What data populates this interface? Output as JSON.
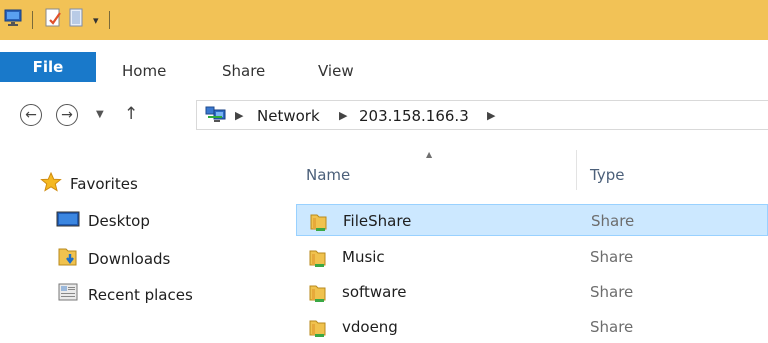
{
  "ribbon": {
    "tabs": [
      "File",
      "Home",
      "Share",
      "View"
    ]
  },
  "address": {
    "breadcrumbs": [
      "Network",
      "203.158.166.3"
    ]
  },
  "nav": {
    "favorites_label": "Favorites",
    "items": [
      "Desktop",
      "Downloads",
      "Recent places"
    ]
  },
  "list": {
    "columns": [
      "Name",
      "Type"
    ],
    "rows": [
      {
        "name": "FileShare",
        "type": "Share"
      },
      {
        "name": "Music",
        "type": "Share"
      },
      {
        "name": "software",
        "type": "Share"
      },
      {
        "name": "vdoeng",
        "type": "Share"
      }
    ]
  },
  "colors": {
    "titlebar": "#f2c256",
    "file_tab": "#1979ca",
    "selection": "#cce8ff"
  }
}
